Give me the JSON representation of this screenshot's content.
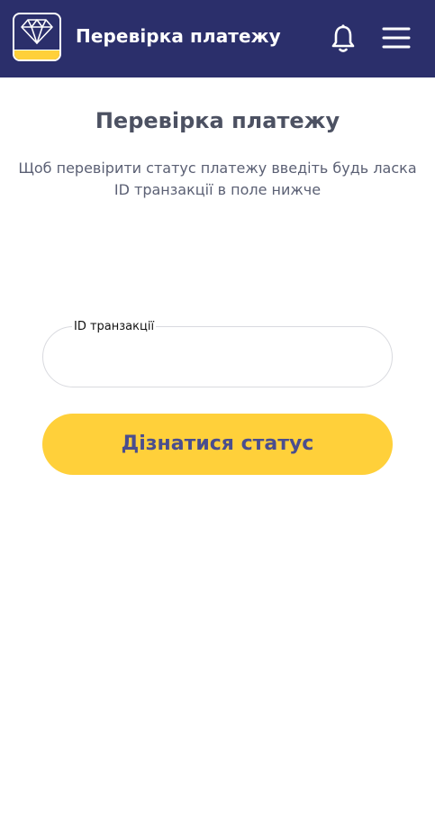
{
  "header": {
    "title": "Перевірка платежу",
    "logo_icon": "diamond-logo-icon",
    "bell_icon": "bell-icon",
    "menu_icon": "hamburger-menu-icon",
    "background_color": "#2b2f6b"
  },
  "main": {
    "title": "Перевірка платежу",
    "description": "Щоб перевірити статус платежу введіть будь ласка ID транзакції в поле нижче"
  },
  "form": {
    "transaction_field_label": "ID транзакції",
    "transaction_field_value": "",
    "submit_label": "Дізнатися статус",
    "submit_color": "#ffd03a"
  }
}
